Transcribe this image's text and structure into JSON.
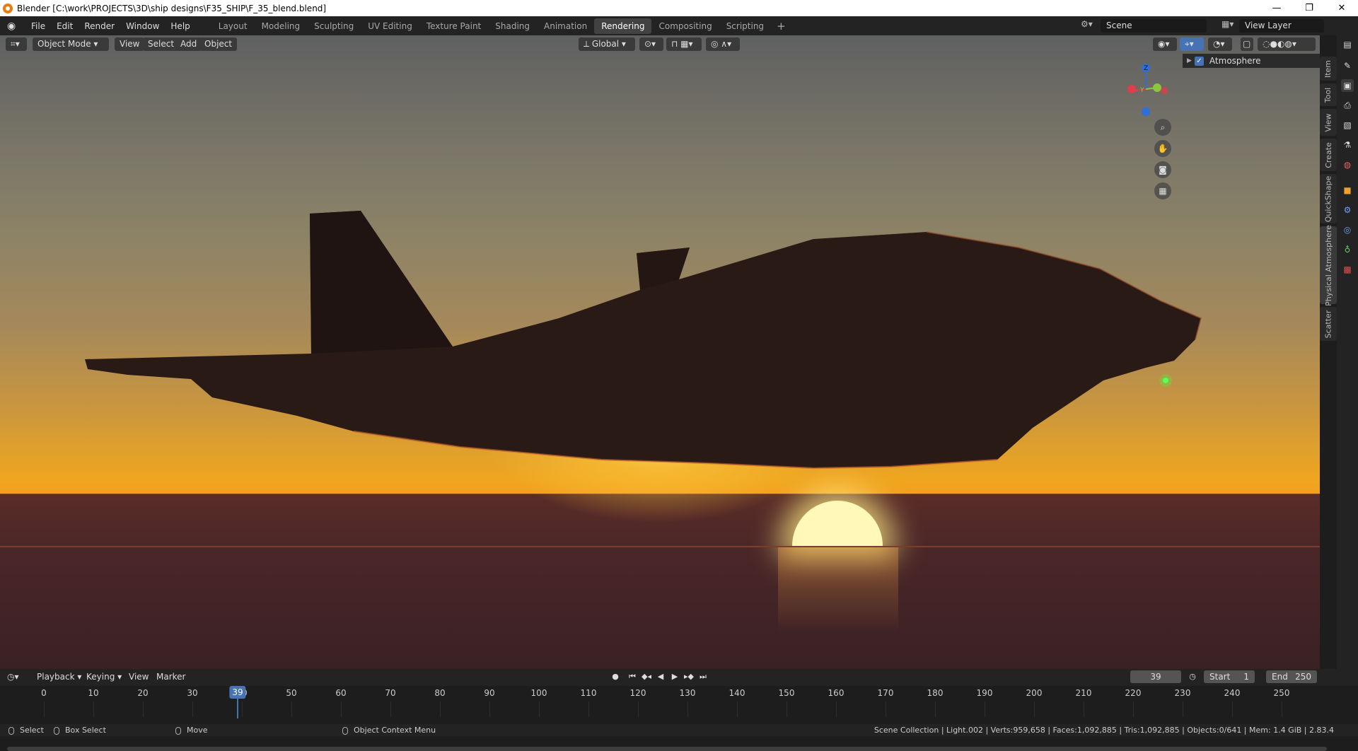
{
  "window": {
    "title": "Blender [C:\\work\\PROJECTS\\3D\\ship designs\\F35_SHIP\\F_35_blend.blend]",
    "minimize": "—",
    "maximize": "❐",
    "close": "✕"
  },
  "menus": [
    "File",
    "Edit",
    "Render",
    "Window",
    "Help"
  ],
  "workspaces": [
    "Layout",
    "Modeling",
    "Sculpting",
    "UV Editing",
    "Texture Paint",
    "Shading",
    "Animation",
    "Rendering",
    "Compositing",
    "Scripting"
  ],
  "active_workspace": "Rendering",
  "scene": {
    "label": "Scene",
    "view_layer": "View Layer"
  },
  "viewport_header": {
    "mode": "Object Mode",
    "view": "View",
    "select": "Select",
    "add": "Add",
    "object": "Object",
    "orientation": "Global"
  },
  "gizmo": {
    "z": "Z",
    "y": "Y"
  },
  "outliner_panel": {
    "item": "Atmosphere",
    "checked": true
  },
  "side_tabs": [
    "Item",
    "Tool",
    "View",
    "Create",
    "QuickShape",
    "Physical Atmosphere",
    "Scatter"
  ],
  "timeline": {
    "menus": [
      "Playback",
      "Keying",
      "View",
      "Marker"
    ],
    "current_frame": "39",
    "start_label": "Start",
    "start": "1",
    "end_label": "End",
    "end": "250",
    "ticks": [
      "0",
      "10",
      "20",
      "30",
      "40",
      "50",
      "60",
      "70",
      "80",
      "90",
      "100",
      "110",
      "120",
      "130",
      "140",
      "150",
      "160",
      "170",
      "180",
      "190",
      "200",
      "210",
      "220",
      "230",
      "240",
      "250"
    ]
  },
  "statusbar": {
    "select": "Select",
    "box_select": "Box Select",
    "move": "Move",
    "context_menu": "Object Context Menu",
    "stats": "Scene Collection | Light.002 | Verts:959,658 | Faces:1,092,885 | Tris:1,092,885 | Objects:0/641 | Mem: 1.4 GiB | 2.83.4"
  },
  "colors": {
    "accent": "#4772b3",
    "active_tab": "#424242"
  }
}
